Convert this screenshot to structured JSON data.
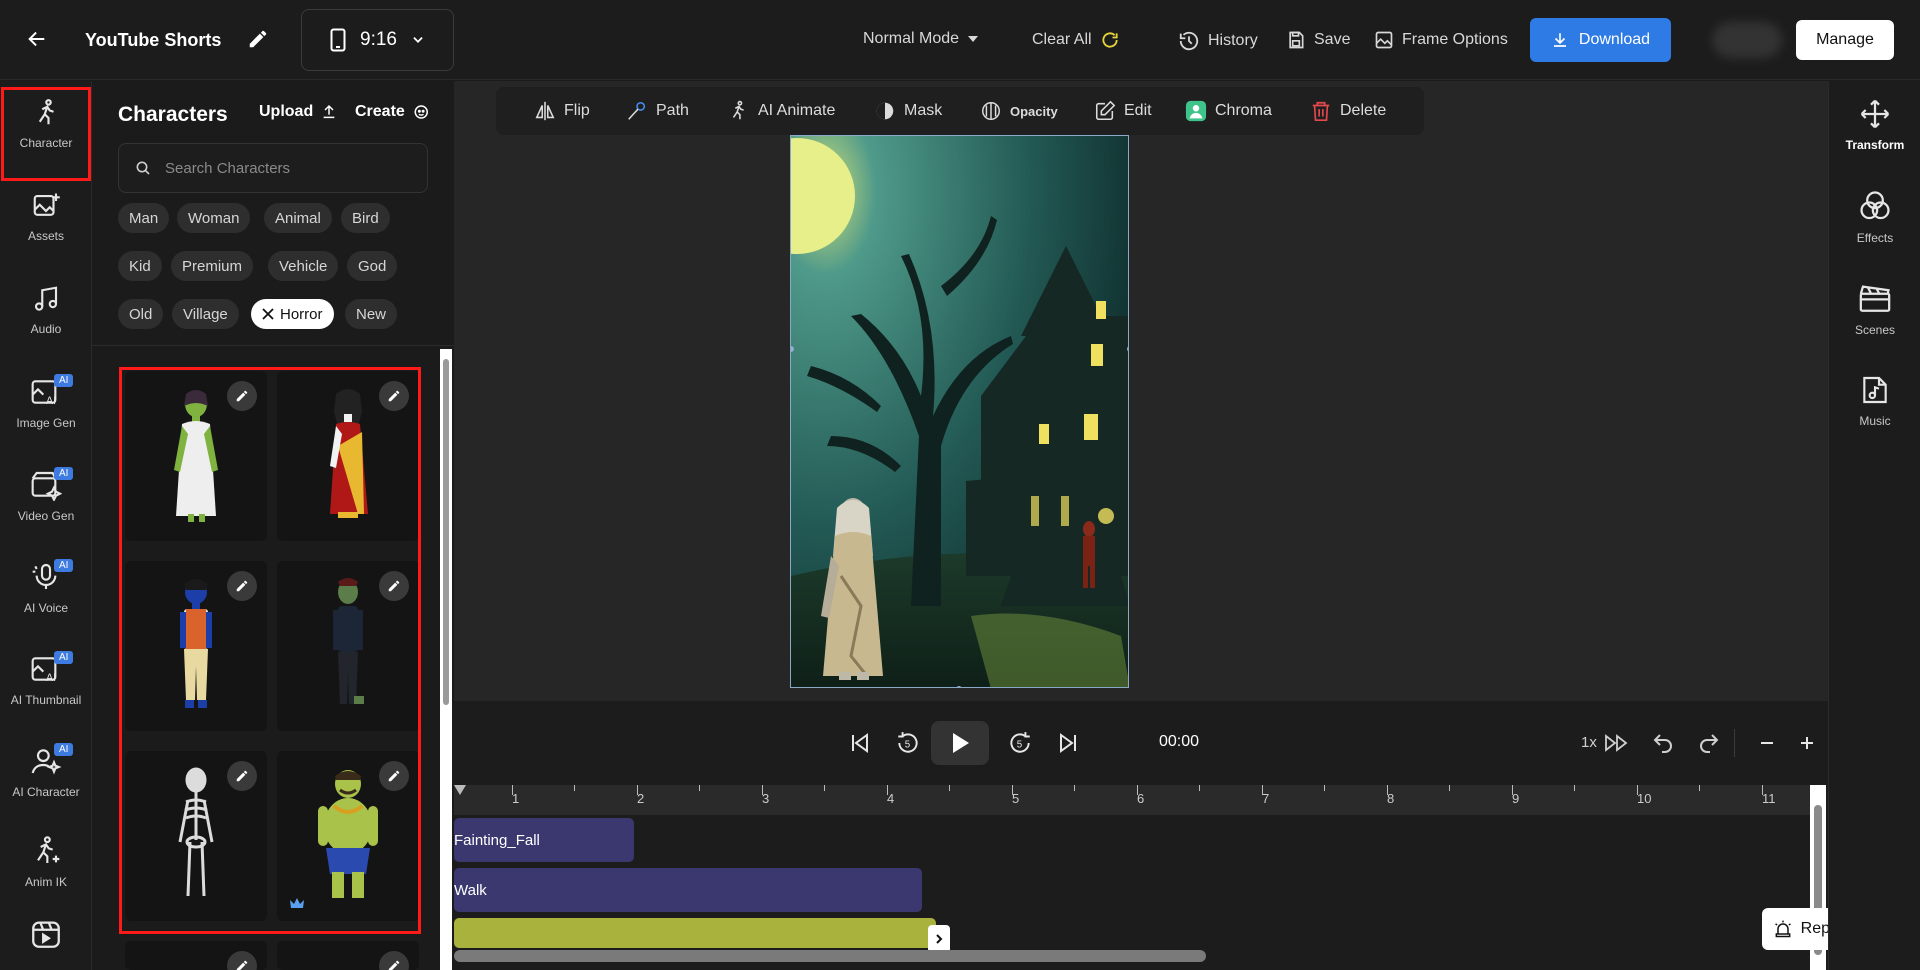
{
  "header": {
    "project_title": "YouTube Shorts",
    "aspect_ratio": "9:16",
    "mode": "Normal Mode",
    "clear_all": "Clear All",
    "history": "History",
    "save": "Save",
    "frame_options": "Frame Options",
    "download": "Download",
    "manage": "Manage"
  },
  "left_rail": {
    "items": [
      {
        "label": "Character",
        "icon": "character-icon",
        "ai": false
      },
      {
        "label": "Assets",
        "icon": "assets-icon",
        "ai": false
      },
      {
        "label": "Audio",
        "icon": "audio-icon",
        "ai": false
      },
      {
        "label": "Image Gen",
        "icon": "image-gen-icon",
        "ai": true
      },
      {
        "label": "Video Gen",
        "icon": "video-gen-icon",
        "ai": true
      },
      {
        "label": "AI Voice",
        "icon": "ai-voice-icon",
        "ai": true
      },
      {
        "label": "AI Thumbnail",
        "icon": "ai-thumbnail-icon",
        "ai": true
      },
      {
        "label": "AI Character",
        "icon": "ai-character-icon",
        "ai": true
      },
      {
        "label": "Anim IK",
        "icon": "anim-ik-icon",
        "ai": false
      }
    ],
    "ai_badge": "AI"
  },
  "characters_panel": {
    "title": "Characters",
    "upload": "Upload",
    "create": "Create",
    "search_placeholder": "Search Characters",
    "filters": [
      "Man",
      "Woman",
      "Animal",
      "Bird",
      "Kid",
      "Premium",
      "Vehicle",
      "God",
      "Old",
      "Village",
      "Horror",
      "New"
    ],
    "active_filter": "Horror"
  },
  "toolbar": {
    "flip": "Flip",
    "path": "Path",
    "ai_animate": "AI Animate",
    "mask": "Mask",
    "opacity": "Opacity",
    "edit": "Edit",
    "chroma": "Chroma",
    "delete": "Delete"
  },
  "transport": {
    "time": "00:00",
    "speed": "1x",
    "rewind_seconds": "5",
    "forward_seconds": "5"
  },
  "timeline": {
    "ruler_labels": [
      "1",
      "2",
      "3",
      "4",
      "5",
      "6",
      "7",
      "8",
      "9",
      "10",
      "11"
    ],
    "clips": [
      {
        "label": "Fainting_Fall",
        "color": "#3b3870"
      },
      {
        "label": "Walk",
        "color": "#3b3870"
      },
      {
        "label": "",
        "color": "#a8b23c"
      }
    ]
  },
  "right_rail": {
    "items": [
      {
        "label": "Transform",
        "icon": "transform-icon"
      },
      {
        "label": "Effects",
        "icon": "effects-icon"
      },
      {
        "label": "Scenes",
        "icon": "scenes-icon"
      },
      {
        "label": "Music",
        "icon": "music-icon"
      }
    ]
  },
  "report_issue": "Report Issue",
  "colors": {
    "accent": "#2f7be5",
    "selection": "#ff1a1a",
    "chroma": "#3ec48a",
    "delete": "#e5484d"
  }
}
